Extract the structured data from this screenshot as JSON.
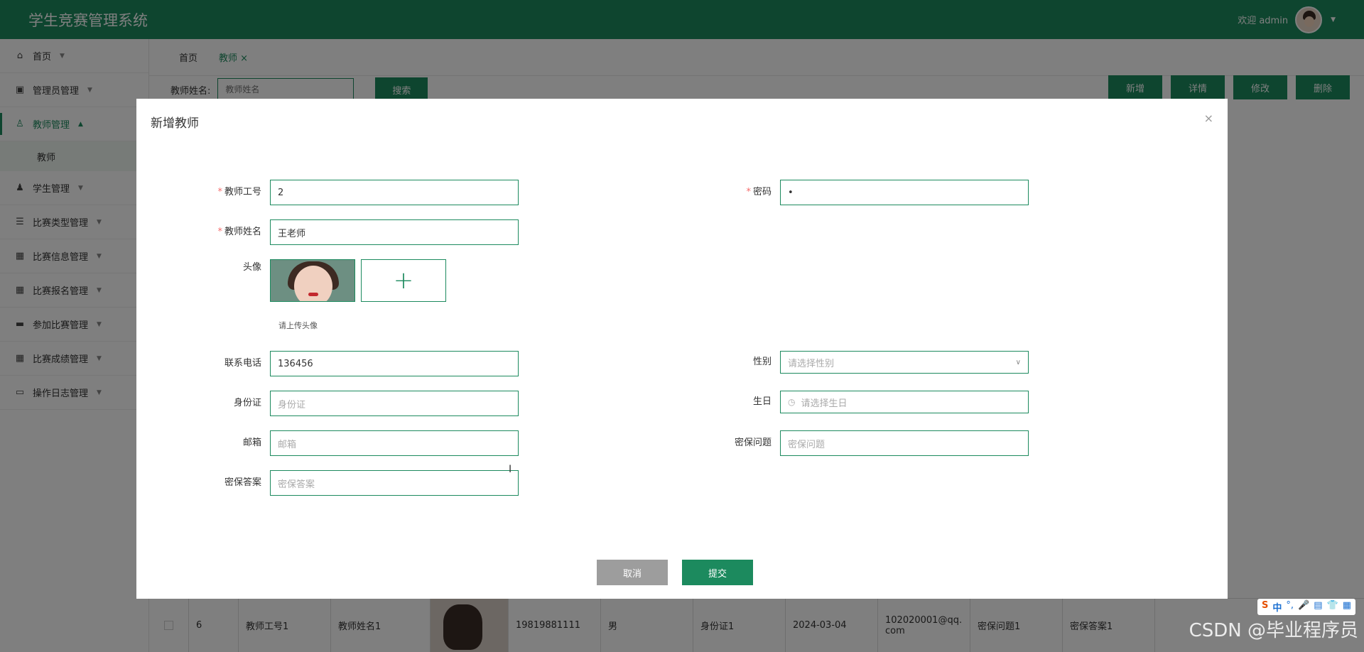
{
  "app": {
    "title": "学生竞赛管理系统",
    "welcome": "欢迎 admin"
  },
  "sidebar": {
    "items": [
      {
        "label": "首页",
        "icon": "home-icon"
      },
      {
        "label": "管理员管理",
        "icon": "chip-icon"
      },
      {
        "label": "教师管理",
        "icon": "user-icon"
      },
      {
        "label": "学生管理",
        "icon": "person-icon"
      },
      {
        "label": "比赛类型管理",
        "icon": "storage-icon"
      },
      {
        "label": "比赛信息管理",
        "icon": "grid-icon"
      },
      {
        "label": "比赛报名管理",
        "icon": "grid-icon"
      },
      {
        "label": "参加比赛管理",
        "icon": "wallet-icon"
      },
      {
        "label": "比赛成绩管理",
        "icon": "grid-icon"
      },
      {
        "label": "操作日志管理",
        "icon": "book-icon"
      }
    ],
    "sub_item": "教师"
  },
  "tabs": {
    "home": "首页",
    "teacher": "教师"
  },
  "search": {
    "label": "教师姓名:",
    "placeholder": "教师姓名",
    "button": "搜索"
  },
  "actions": {
    "add": "新增",
    "detail": "详情",
    "edit": "修改",
    "delete": "删除"
  },
  "table_row": {
    "index": "6",
    "teacher_no": "教师工号1",
    "teacher_name": "教师姓名1",
    "phone": "19819881111",
    "gender": "男",
    "id_card": "身份证1",
    "birthday": "2024-03-04",
    "email": "102020001@qq.com",
    "question": "密保问题1",
    "answer": "密保答案1"
  },
  "modal": {
    "title": "新增教师",
    "close": "×",
    "fields": {
      "teacher_no": {
        "label": "教师工号",
        "value": "2"
      },
      "password": {
        "label": "密码",
        "value": "•"
      },
      "teacher_name": {
        "label": "教师姓名",
        "value": "王老师"
      },
      "avatar": {
        "label": "头像",
        "tip": "请上传头像",
        "add": "+"
      },
      "phone": {
        "label": "联系电话",
        "value": "136456"
      },
      "gender": {
        "label": "性别",
        "placeholder": "请选择性别"
      },
      "id_card": {
        "label": "身份证",
        "placeholder": "身份证"
      },
      "birthday": {
        "label": "生日",
        "placeholder": "请选择生日"
      },
      "email": {
        "label": "邮箱",
        "placeholder": "邮箱"
      },
      "question": {
        "label": "密保问题",
        "placeholder": "密保问题"
      },
      "answer": {
        "label": "密保答案",
        "placeholder": "密保答案"
      }
    },
    "cancel": "取消",
    "submit": "提交"
  },
  "watermark": "CSDN @毕业程序员",
  "ime": {
    "s": "S",
    "zh": "中"
  },
  "colors": {
    "primary": "#1c8a5e",
    "required": "#f56c6c",
    "cancel": "#9d9d9d"
  }
}
